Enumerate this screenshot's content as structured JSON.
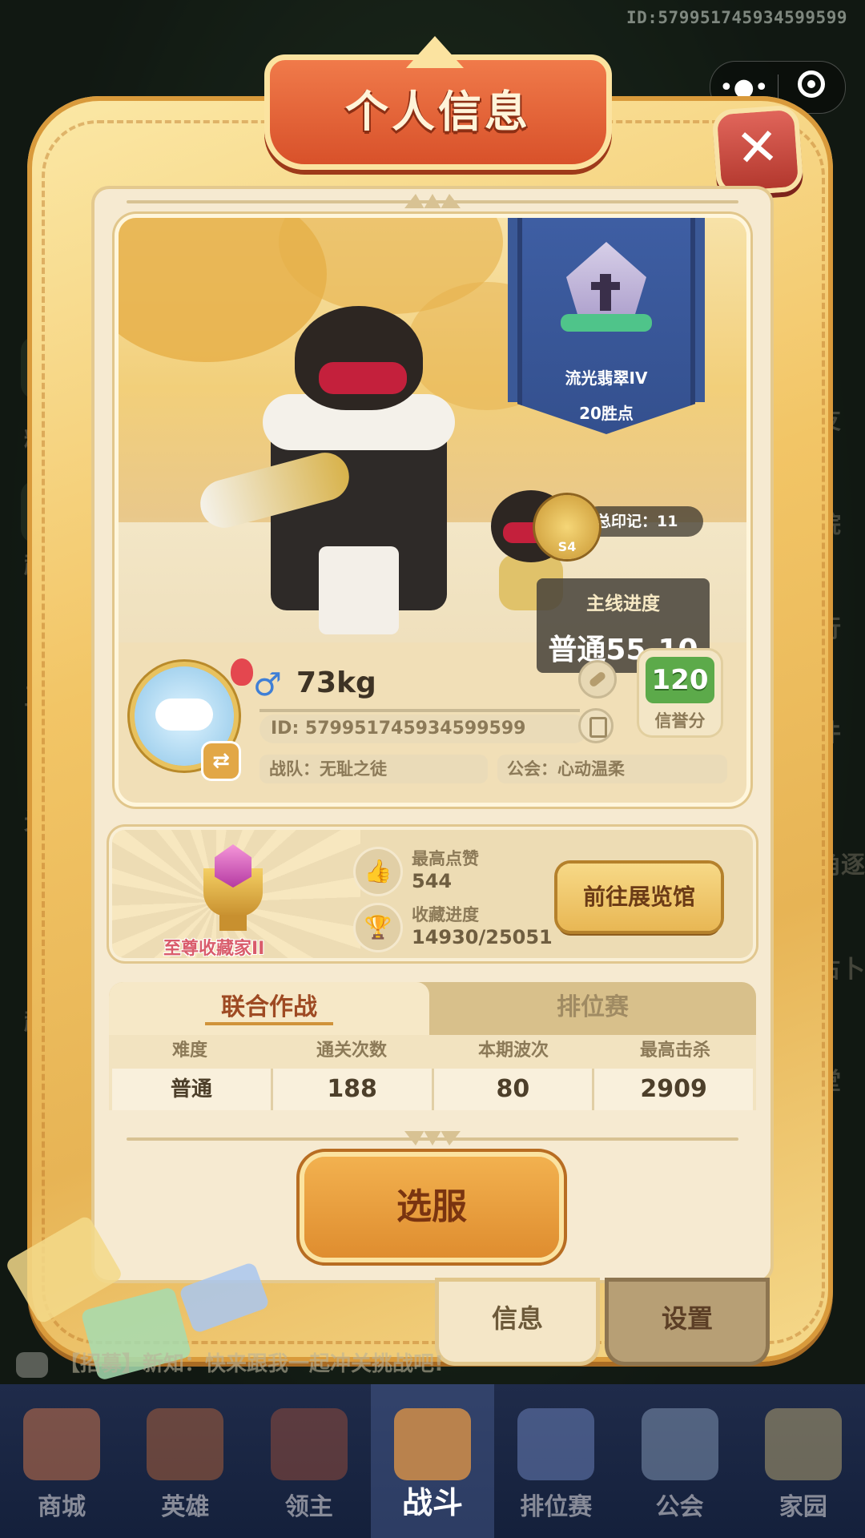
{
  "top": {
    "uid_watermark": "ID:579951745934599599"
  },
  "capsule": {
    "more_icon": "dots-icon",
    "close_icon": "target-icon"
  },
  "dialog": {
    "title": "个人信息"
  },
  "rank": {
    "name": "流光翡翠IV",
    "points": "20胜点"
  },
  "seals": {
    "season": "S4",
    "label": "总印记：11"
  },
  "main_progress": {
    "label": "主线进度",
    "value": "普通55-10"
  },
  "profile": {
    "gender_symbol": "♂",
    "nickname": "73kg",
    "id": "ID:  579951745934599599",
    "team": "战队：无耻之徒",
    "guild": "公会：心动温柔",
    "credit_value": "120",
    "credit_label": "信誉分"
  },
  "collection": {
    "title": "至尊收藏家II",
    "likes_label": "最高点赞",
    "likes_value": "544",
    "progress_label": "收藏进度",
    "progress_value": "14930/25051",
    "gallery_button": "前往展览馆"
  },
  "tabs": {
    "active": "联合作战",
    "inactive": "排位赛"
  },
  "table": {
    "headers": [
      "难度",
      "通关次数",
      "本期波次",
      "最高击杀"
    ],
    "row": [
      "普通",
      "188",
      "80",
      "2909"
    ]
  },
  "select_server": "选服",
  "bottom_tabs": {
    "info": "信息",
    "settings": "设置"
  },
  "chat": {
    "text": "【招募】新知：快来跟我一起冲关挑战吧!"
  },
  "side_left": [
    "精彩",
    "超值",
    "五圣",
    "光影",
    "超值"
  ],
  "side_right": [
    "好友",
    "学院",
    "排行",
    "邮件",
    "视角逐",
    "日占卜",
    "课堂"
  ],
  "nav": [
    {
      "label": "商城",
      "icon": "shop-icon"
    },
    {
      "label": "英雄",
      "icon": "hero-card-icon"
    },
    {
      "label": "领主",
      "icon": "lord-banner-icon"
    },
    {
      "label": "战斗",
      "icon": "battle-swords-icon"
    },
    {
      "label": "排位赛",
      "icon": "ranked-shield-icon"
    },
    {
      "label": "公会",
      "icon": "guild-castle-icon"
    },
    {
      "label": "家园",
      "icon": "home-house-icon"
    }
  ],
  "colors": {
    "accent": "#e8b754",
    "title_banner": "#d8512a",
    "nav_bg": "#1f2b4a"
  }
}
